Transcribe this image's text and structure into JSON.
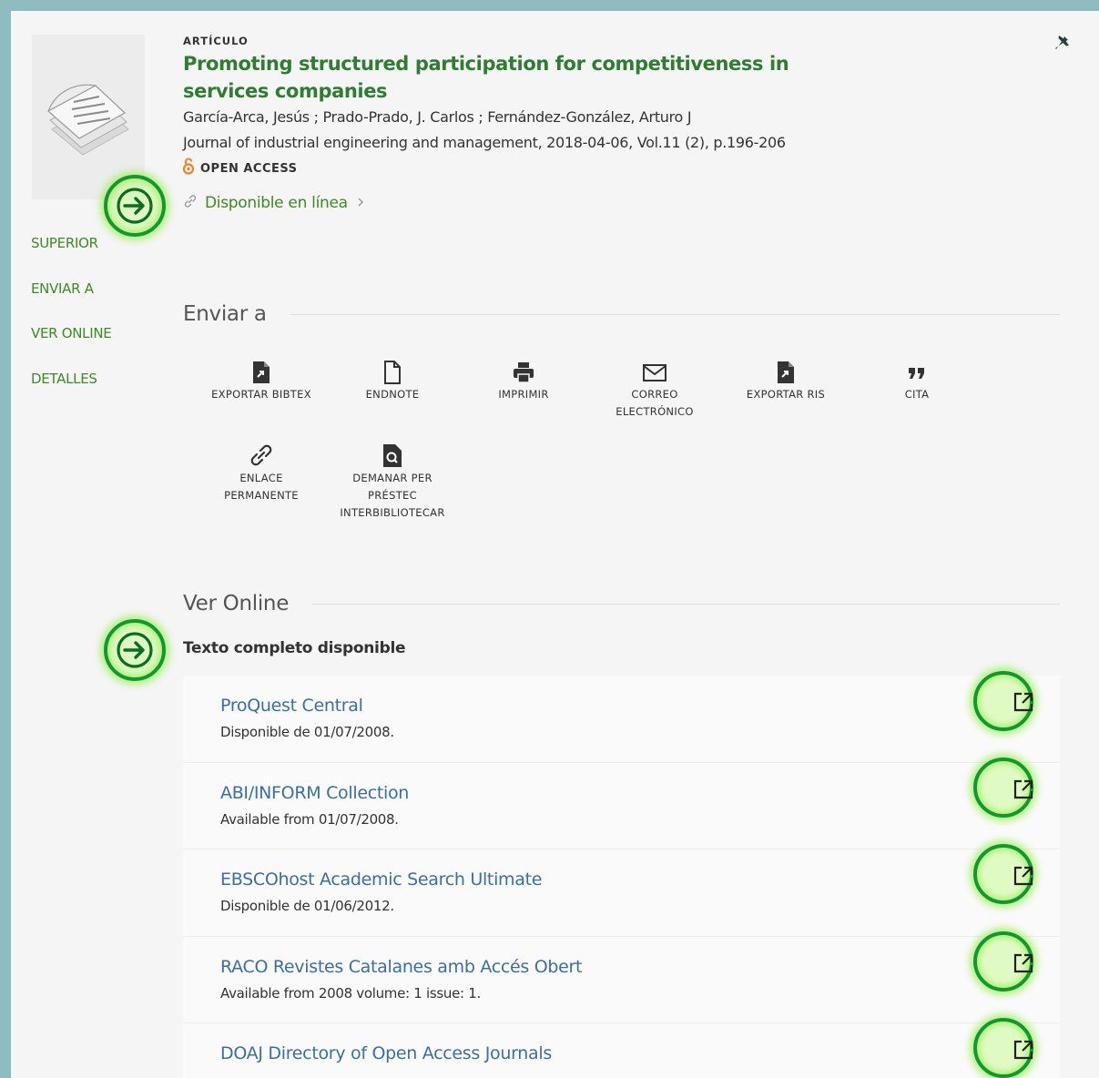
{
  "record": {
    "type": "ARTÍCULO",
    "title": "Promoting structured participation for competitiveness in services companies",
    "authors": "García-Arca, Jesús ; Prado-Prado, J. Carlos ; Fernández-González, Arturo J",
    "source": "Journal of industrial engineering and management, 2018-04-06, Vol.11 (2), p.196-206",
    "open_access": "OPEN ACCESS",
    "availability": "Disponible en línea"
  },
  "nav": [
    "SUPERIOR",
    "ENVIAR A",
    "VER ONLINE",
    "DETALLES"
  ],
  "send_to": {
    "heading": "Enviar a",
    "actions": [
      {
        "label": "EXPORTAR BIBTEX",
        "icon": "file-export-icon"
      },
      {
        "label": "ENDNOTE",
        "icon": "file-icon"
      },
      {
        "label": "IMPRIMIR",
        "icon": "printer-icon"
      },
      {
        "label": "CORREO ELECTRÓNICO",
        "icon": "envelope-icon"
      },
      {
        "label": "EXPORTAR RIS",
        "icon": "file-export-icon"
      },
      {
        "label": "CITA",
        "icon": "quote-icon"
      },
      {
        "label": "ENLACE PERMANENTE",
        "icon": "link-icon"
      },
      {
        "label": "DEMANAR PER PRÉSTEC INTERBIBLIOTECAR",
        "icon": "file-search-icon"
      }
    ]
  },
  "view_online": {
    "heading": "Ver Online",
    "subheading": "Texto completo disponible",
    "sources": [
      {
        "name": "ProQuest Central",
        "coverage": "Disponible de 01/07/2008."
      },
      {
        "name": "ABI/INFORM Collection",
        "coverage": "Available from 01/07/2008."
      },
      {
        "name": "EBSCOhost Academic Search Ultimate",
        "coverage": "Disponible de 01/06/2012."
      },
      {
        "name": "RACO Revistes Catalanes amb Accés Obert",
        "coverage": "Available from 2008 volume: 1 issue: 1."
      },
      {
        "name": "DOAJ Directory of Open Access Journals",
        "coverage": ""
      }
    ]
  },
  "colors": {
    "accent_green": "#3d8b22",
    "link_blue": "#3a6fa6",
    "open_access_orange": "#f38020",
    "highlight_ring": "#0e9a2e"
  }
}
